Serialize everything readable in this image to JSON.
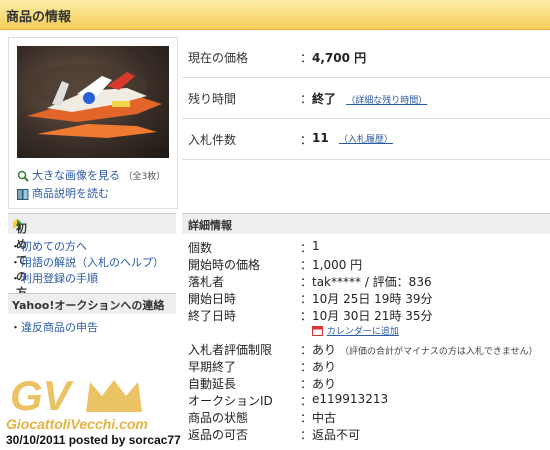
{
  "header": {
    "title": "商品の情報"
  },
  "image_panel": {
    "enlarge_label": "大きな画像を見る",
    "count_label": "（全3枚）",
    "description_label": "商品説明を読む"
  },
  "price_info": {
    "rows": [
      {
        "label": "現在の価格",
        "value": "4,700 円",
        "link": ""
      },
      {
        "label": "残り時間",
        "value": "終了",
        "link": "（詳細な残り時間）"
      },
      {
        "label": "入札件数",
        "value": "11",
        "link": "（入札履歴）"
      }
    ],
    "colon": "："
  },
  "sidebar": {
    "beginners": {
      "heading": "初めての方",
      "links": [
        "初めての方へ",
        "用語の解説（入札のヘルプ）",
        "利用登録の手順"
      ]
    },
    "contact": {
      "heading": "Yahoo!オークションへの連絡",
      "links": [
        "違反商品の申告"
      ]
    }
  },
  "details": {
    "heading": "詳細情報",
    "rows": [
      {
        "label": "個数",
        "value": "1"
      },
      {
        "label": "開始時の価格",
        "value": "1,000 円"
      },
      {
        "label": "落札者",
        "value": "tak***** / 評価：836"
      },
      {
        "label": "開始日時",
        "value": "10月 25日 19時 39分"
      },
      {
        "label": "終了日時",
        "value": "10月 30日 21時 35分"
      },
      {
        "label": "",
        "value": "カレンダーに追加"
      },
      {
        "label": "入札者評価制限",
        "value": "あり",
        "note": "（評価の合計がマイナスの方は入札できません）"
      },
      {
        "label": "早期終了",
        "value": "あり"
      },
      {
        "label": "自動延長",
        "value": "あり"
      },
      {
        "label": "オークションID",
        "value": "e119913213"
      },
      {
        "label": "商品の状態",
        "value": "中古"
      },
      {
        "label": "返品の可否",
        "value": "返品不可"
      }
    ]
  },
  "watermark": {
    "logo_text": "GV",
    "site": "GiocattoliVecchi.com",
    "credit": "30/10/2011 posted by sorcac77"
  }
}
